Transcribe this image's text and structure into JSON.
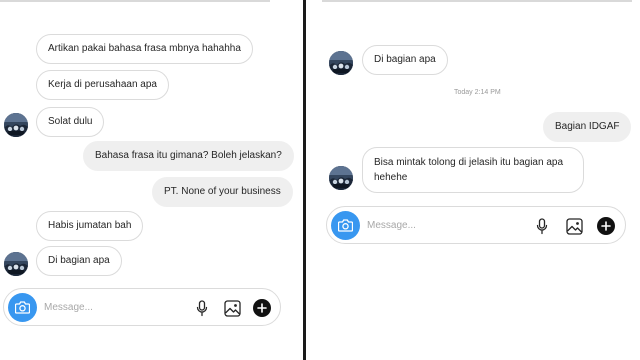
{
  "left_panel": {
    "messages": [
      {
        "text": "Artikan pakai bahasa frasa mbnya hahahha",
        "side": "received"
      },
      {
        "text": "Kerja di perusahaan apa",
        "side": "received"
      },
      {
        "text": "Solat dulu",
        "side": "received"
      },
      {
        "text": "Bahasa frasa itu gimana? Boleh jelaskan?",
        "side": "sent"
      },
      {
        "text": "PT. None of your business",
        "side": "sent"
      },
      {
        "text": "Habis jumatan bah",
        "side": "received"
      },
      {
        "text": "Di bagian apa",
        "side": "received"
      }
    ],
    "composer": {
      "placeholder": "Message..."
    }
  },
  "right_panel": {
    "messages": [
      {
        "text": "Di bagian apa",
        "side": "received"
      },
      {
        "text": "Bagian IDGAF",
        "side": "sent"
      },
      {
        "text": "Bisa mintak tolong di jelasih itu bagian apa hehehe",
        "side": "received"
      }
    ],
    "timestamp": "Today 2:14 PM",
    "composer": {
      "placeholder": "Message..."
    }
  },
  "colors": {
    "accent": "#3897f0",
    "sent_bubble": "#efefef",
    "received_border": "#dbdbdb",
    "divider": "#1a1a1a"
  },
  "icons": [
    "avatar",
    "camera-icon",
    "microphone-icon",
    "image-icon",
    "plus-icon"
  ]
}
